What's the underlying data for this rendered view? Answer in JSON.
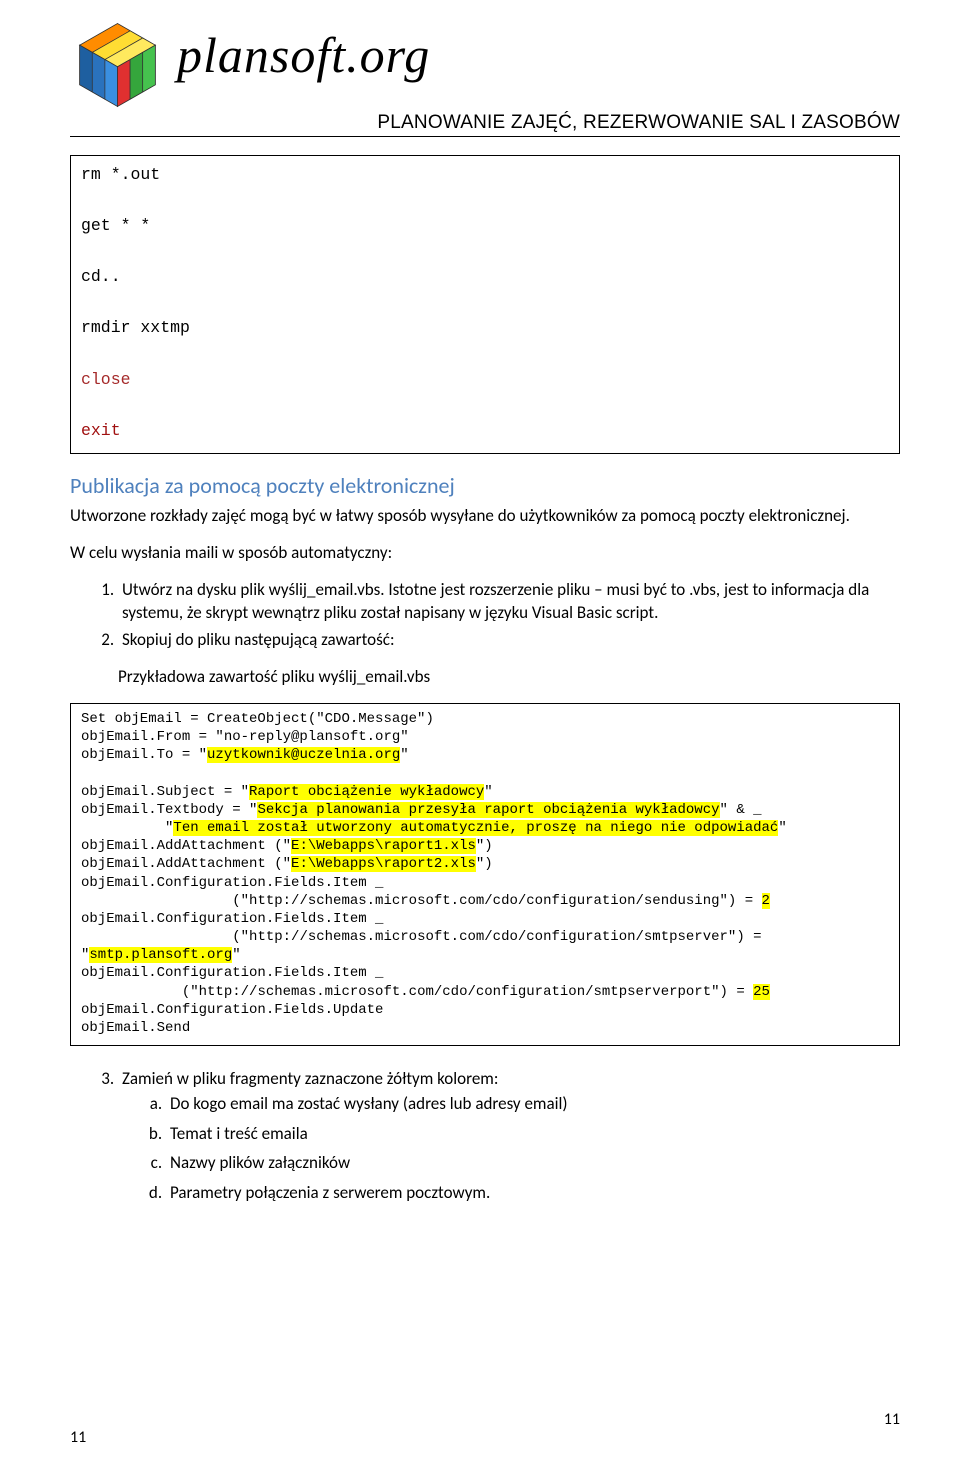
{
  "header": {
    "brand": "plansoft.org",
    "subtitle": "PLANOWANIE ZAJĘĆ, REZERWOWANIE SAL I ZASOBÓW"
  },
  "code1": {
    "l1": "rm *.out",
    "l2": "get * *",
    "l3": "cd..",
    "l4": "rmdir xxtmp",
    "l5": "close",
    "l6": "exit"
  },
  "section": {
    "heading": "Publikacja za pomocą poczty elektronicznej",
    "intro": "Utworzone rozkłady zajęć mogą być w łatwy sposób wysyłane do użytkowników za pomocą poczty elektronicznej.",
    "lead": "W celu wysłania maili w sposób automatyczny:",
    "li1": "Utwórz na dysku plik wyślij_email.vbs.  Istotne jest rozszerzenie pliku – musi być to .vbs, jest to informacja dla systemu, że skrypt wewnątrz pliku został napisany w języku Visual Basic script.",
    "li2": "Skopiuj do pliku następującą zawartość:",
    "example_label": "Przykładowa zawartość pliku wyślij_email.vbs"
  },
  "vbs": {
    "l01": "Set objEmail = CreateObject(\"CDO.Message\")",
    "l02": "objEmail.From = \"no-reply@plansoft.org\"",
    "l03a": "objEmail.To = \"",
    "l03b": "uzytkownik@uczelnia.org",
    "l03c": "\"",
    "l04a": "objEmail.Subject = \"",
    "l04b": "Raport obciążenie wykładowcy",
    "l04c": "\"",
    "l05a": "objEmail.Textbody = \"",
    "l05b": "Sekcja planowania przesyła raport obciążenia wykładowcy",
    "l05c": "\" & _",
    "l06a": "          \"",
    "l06b": "Ten email został utworzony automatycznie, proszę na niego nie odpowiadać",
    "l06c": "\"",
    "l07a": "objEmail.AddAttachment (\"",
    "l07b": "E:\\Webapps\\raport1.xls",
    "l07c": "\")",
    "l08a": "objEmail.AddAttachment (\"",
    "l08b": "E:\\Webapps\\raport2.xls",
    "l08c": "\")",
    "l09": "objEmail.Configuration.Fields.Item _",
    "l10a": "                  (\"http://schemas.microsoft.com/cdo/configuration/sendusing\") = ",
    "l10b": "2",
    "l11": "objEmail.Configuration.Fields.Item _",
    "l12a": "                  (\"http://schemas.microsoft.com/cdo/configuration/smtpserver\") = \"",
    "l12b": "smtp.plansoft.org",
    "l12c": "\"",
    "l13": "objEmail.Configuration.Fields.Item _",
    "l14a": "            (\"http://schemas.microsoft.com/cdo/configuration/smtpserverport\") = ",
    "l14b": "25",
    "l15": "objEmail.Configuration.Fields.Update",
    "l16": "objEmail.Send"
  },
  "post": {
    "li3": "Zamień w pliku fragmenty zaznaczone żółtym kolorem:",
    "a": "Do kogo email ma zostać wysłany (adres lub adresy email)",
    "b": "Temat i treść emaila",
    "c": "Nazwy plików załączników",
    "d": "Parametry połączenia z serwerem pocztowym."
  },
  "footer": {
    "left": "11",
    "right": "11"
  }
}
